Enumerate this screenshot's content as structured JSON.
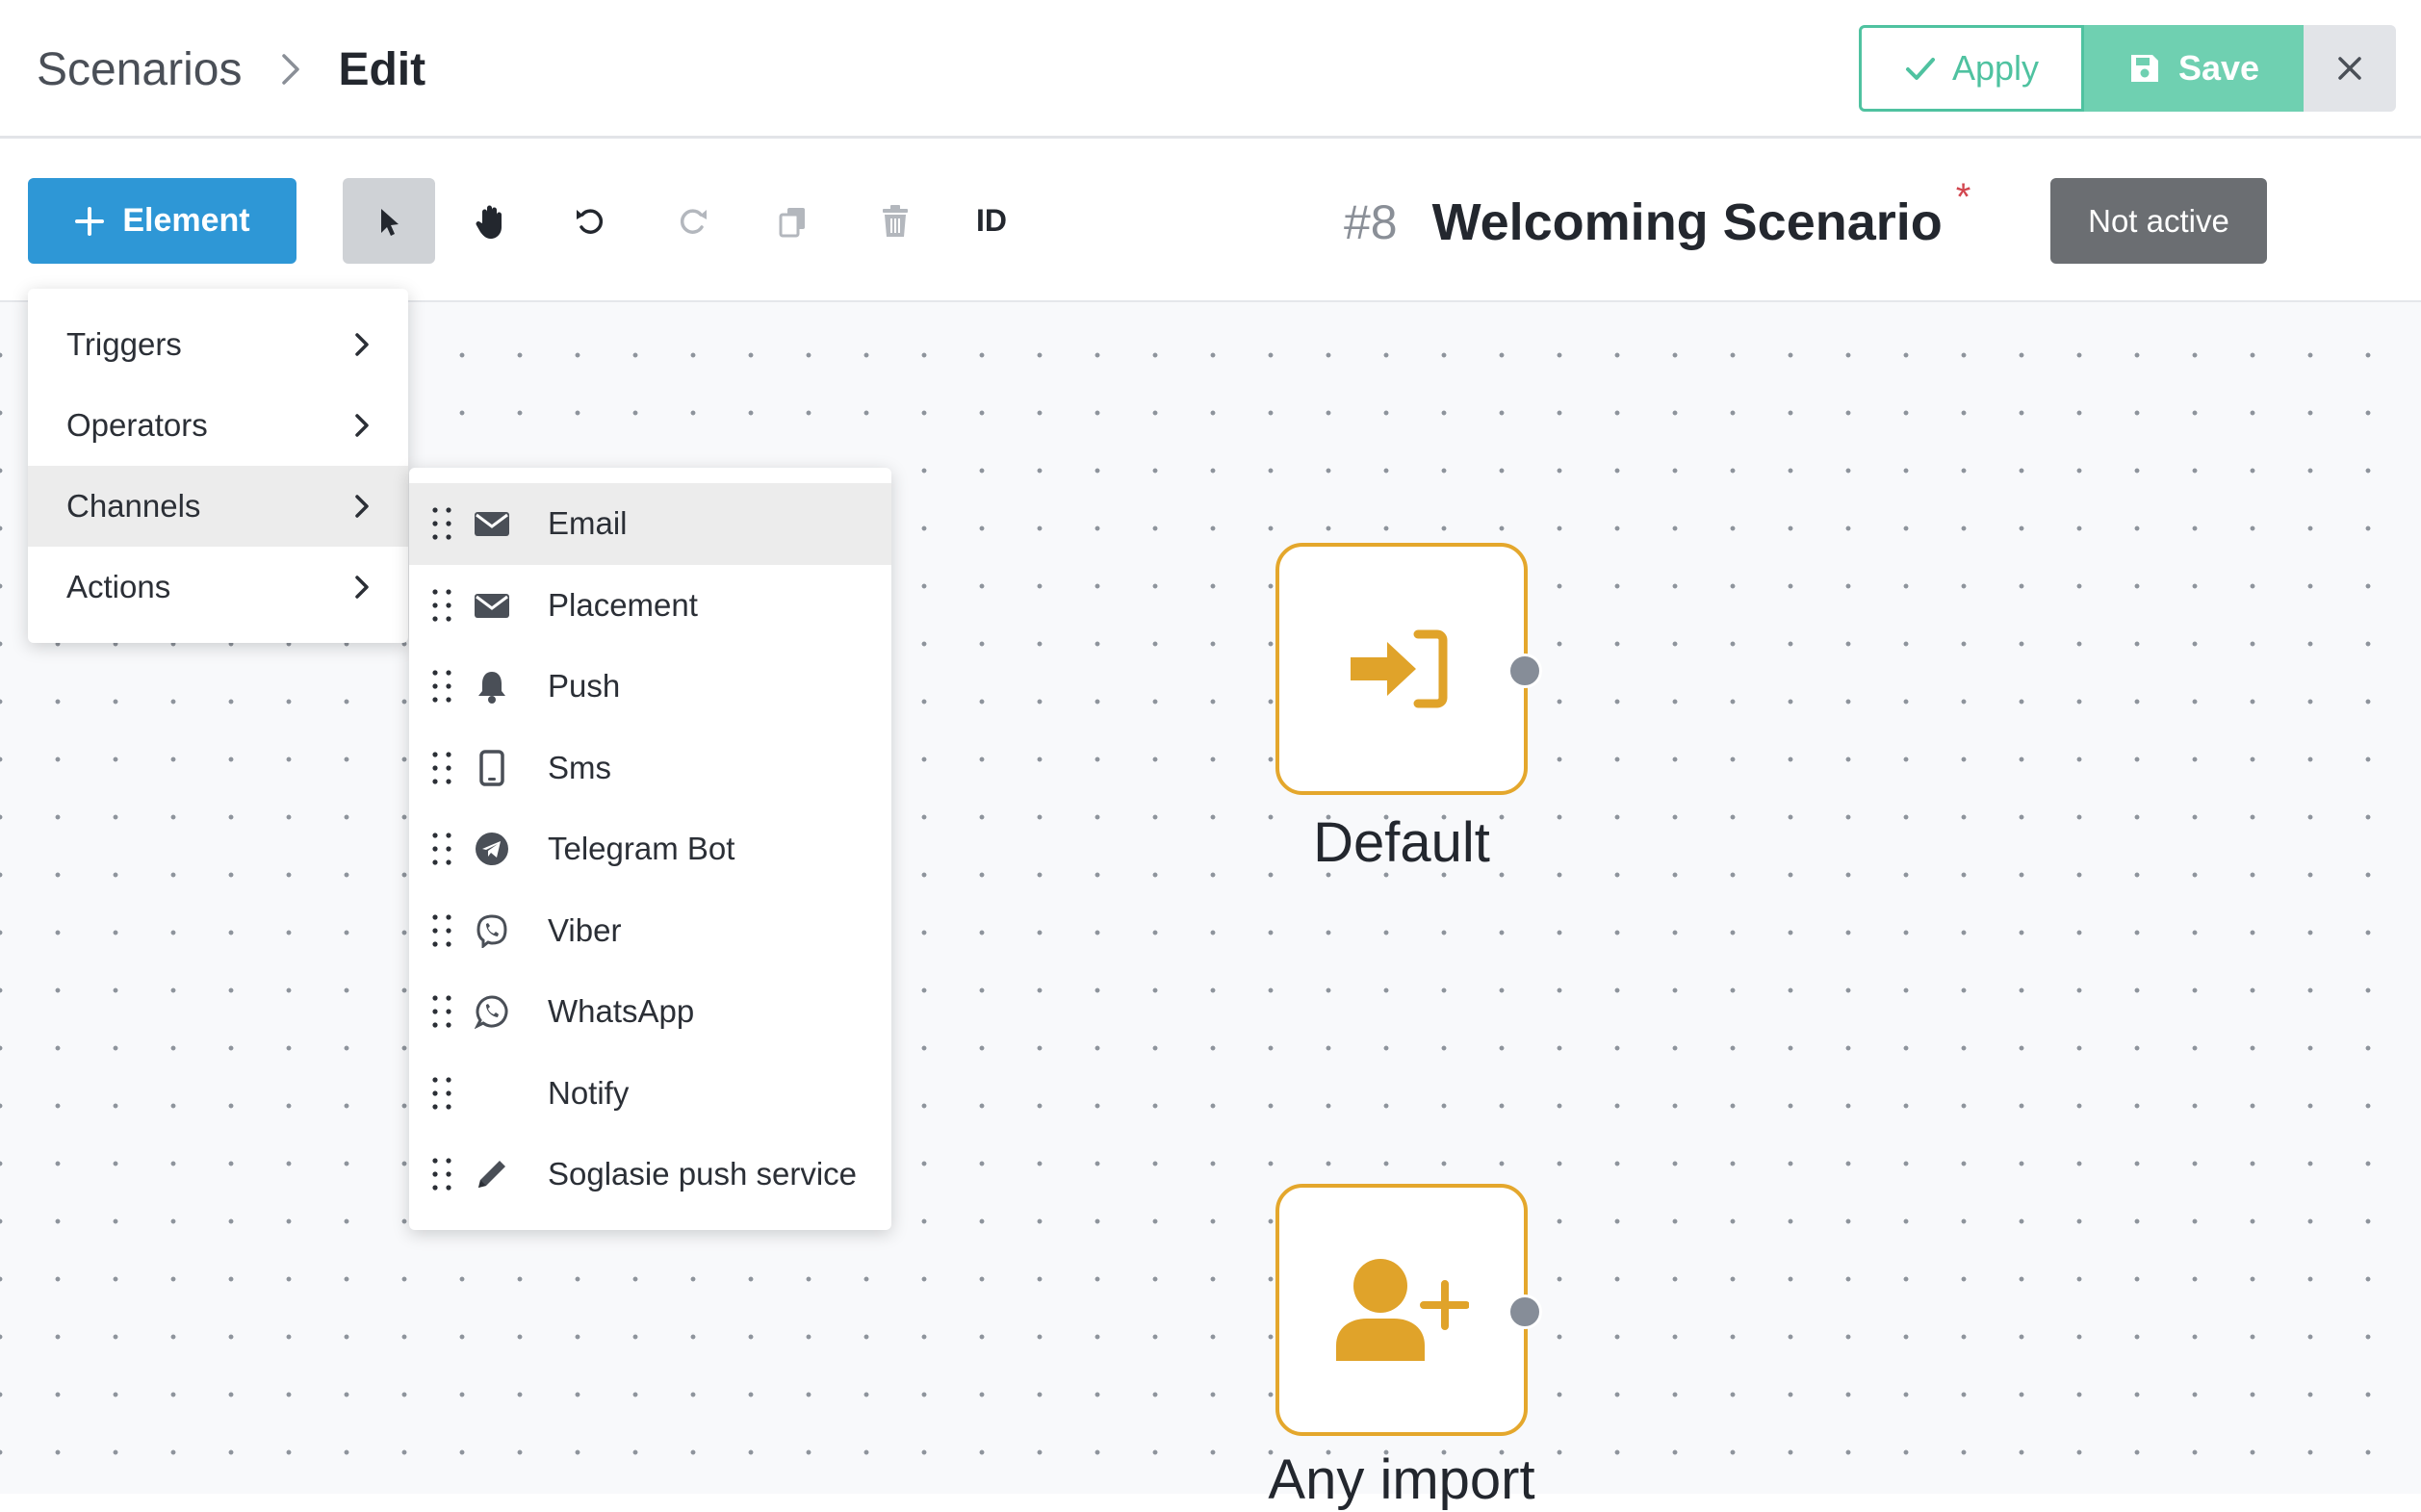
{
  "header": {
    "breadcrumb_root": "Scenarios",
    "breadcrumb_current": "Edit",
    "apply_label": "Apply",
    "save_label": "Save"
  },
  "toolbar": {
    "element_label": "Element",
    "id_label": "ID",
    "scenario_number": "#8",
    "scenario_name": "Welcoming Scenario",
    "unsaved_marker": "*",
    "status": "Not active"
  },
  "menu": {
    "items": [
      {
        "label": "Triggers"
      },
      {
        "label": "Operators"
      },
      {
        "label": "Channels"
      },
      {
        "label": "Actions"
      }
    ],
    "active_index": 2
  },
  "channels_menu": {
    "items": [
      {
        "label": "Email",
        "icon": "envelope-icon"
      },
      {
        "label": "Placement",
        "icon": "envelope-icon"
      },
      {
        "label": "Push",
        "icon": "bell-icon"
      },
      {
        "label": "Sms",
        "icon": "mobile-icon"
      },
      {
        "label": "Telegram Bot",
        "icon": "telegram-icon"
      },
      {
        "label": "Viber",
        "icon": "viber-icon"
      },
      {
        "label": "WhatsApp",
        "icon": "whatsapp-icon"
      },
      {
        "label": "Notify",
        "icon": ""
      },
      {
        "label": "Soglasie push service",
        "icon": "pencil-icon"
      }
    ],
    "active_index": 0
  },
  "canvas": {
    "nodes": [
      {
        "label": "Default",
        "icon": "sign-in-icon"
      },
      {
        "label": "Any import",
        "icon": "user-plus-icon"
      }
    ]
  },
  "colors": {
    "accent_blue": "#2e97d6",
    "accent_green": "#4fc2a0",
    "save_green": "#6fd0b1",
    "node_orange": "#e4a72c",
    "status_gray": "#6b6e72"
  }
}
